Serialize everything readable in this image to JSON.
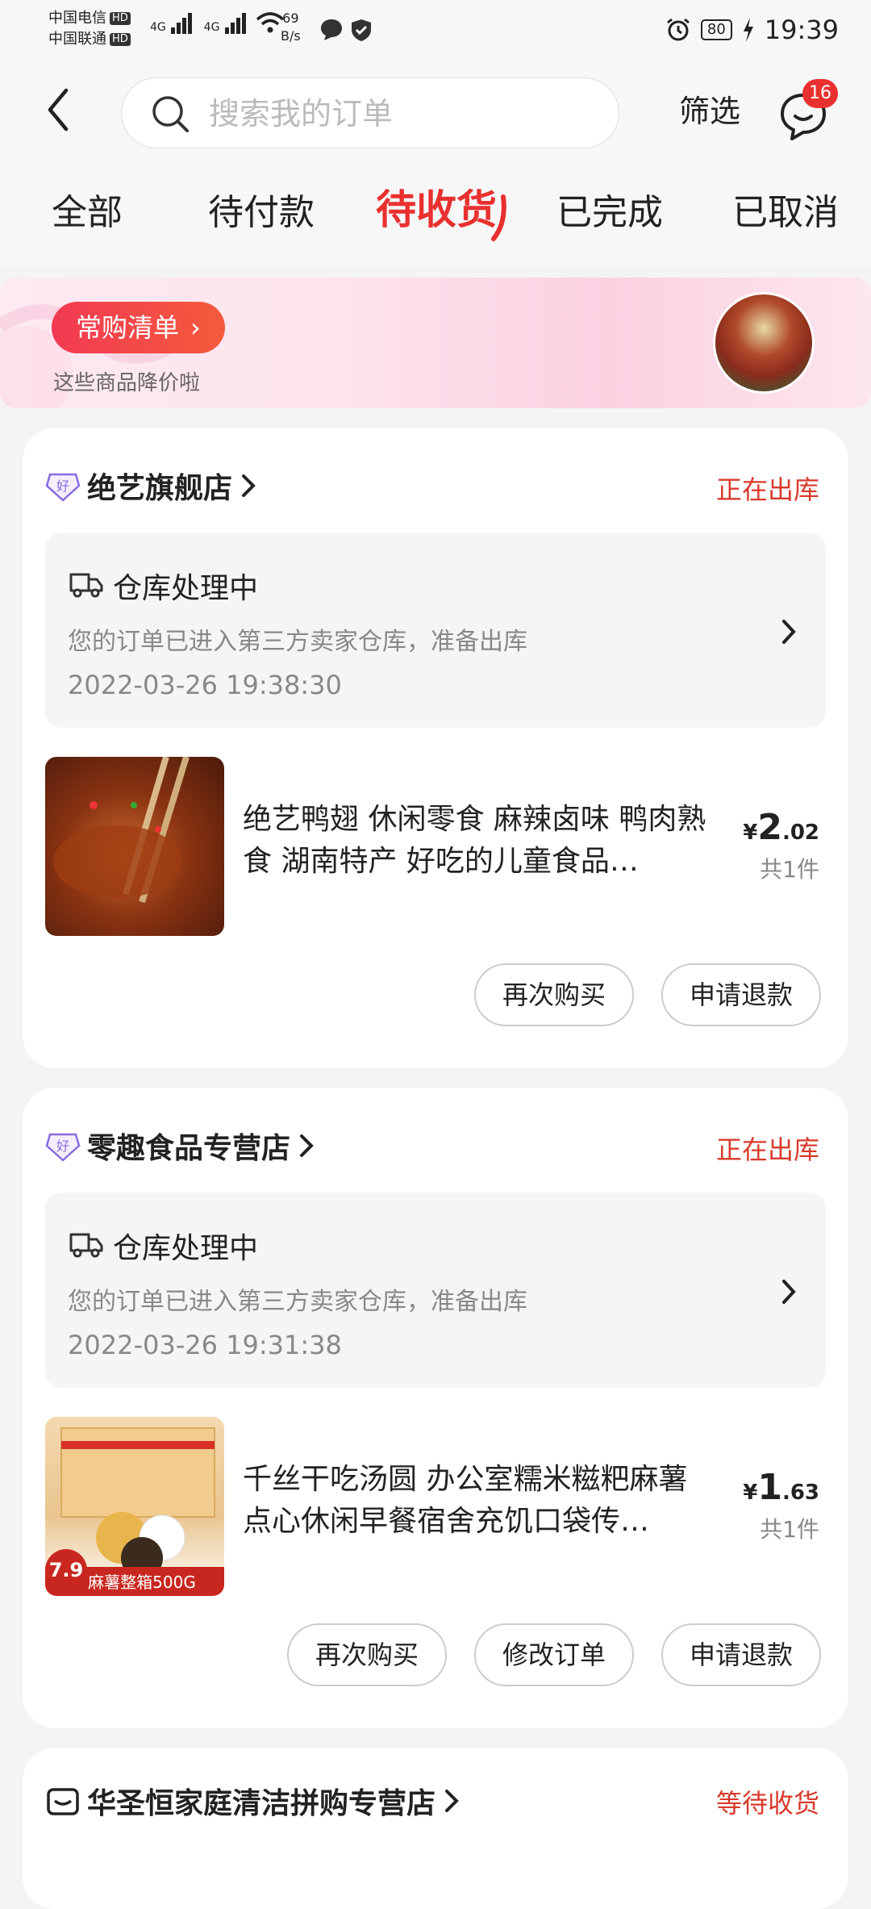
{
  "status_bar": {
    "carrier1": "中国电信",
    "carrier2": "中国联通",
    "hd": "HD",
    "net1": "4G",
    "net2": "4G",
    "speed_value": "69",
    "speed_unit": "B/s",
    "battery": "80",
    "time": "19:39"
  },
  "header": {
    "search_placeholder": "搜索我的订单",
    "filter_label": "筛选",
    "message_badge": "16"
  },
  "tabs": [
    {
      "label": "全部"
    },
    {
      "label": "待付款"
    },
    {
      "label": "待收货",
      "active": true
    },
    {
      "label": "已完成"
    },
    {
      "label": "已取消"
    }
  ],
  "promo": {
    "button_label": "常购清单",
    "subtitle": "这些商品降价啦"
  },
  "orders": [
    {
      "shop": "绝艺旗舰店",
      "status": "正在出库",
      "shipment": {
        "title": "仓库处理中",
        "desc": "您的订单已进入第三方卖家仓库，准备出库",
        "time": "2022-03-26 19:38:30"
      },
      "product": {
        "name": "绝艺鸭翅 休闲零食 麻辣卤味 鸭肉熟食 湖南特产 好吃的儿童食品…",
        "currency": "¥",
        "price_int": "2",
        "price_dec": ".02",
        "qty": "共1件"
      },
      "buttons": [
        "再次购买",
        "申请退款"
      ]
    },
    {
      "shop": "零趣食品专营店",
      "status": "正在出库",
      "shipment": {
        "title": "仓库处理中",
        "desc": "您的订单已进入第三方卖家仓库，准备出库",
        "time": "2022-03-26 19:31:38"
      },
      "product": {
        "name": "千丝干吃汤圆 办公室糯米糍粑麻薯点心休闲早餐宿舍充饥口袋传…",
        "currency": "¥",
        "price_int": "1",
        "price_dec": ".63",
        "qty": "共1件",
        "thumb_label": "麻薯整箱500G",
        "thumb_price": "7.9"
      },
      "buttons": [
        "再次购买",
        "修改订单",
        "申请退款"
      ]
    },
    {
      "shop": "华圣恒家庭清洁拼购专营店",
      "status": "等待收货"
    }
  ],
  "colors": {
    "accent": "#e8312f",
    "status_red": "#d93a2b",
    "background": "#f4f4f4"
  }
}
